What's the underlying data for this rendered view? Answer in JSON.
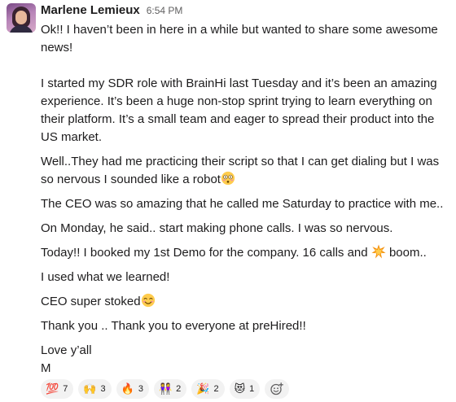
{
  "message": {
    "author": "Marlene Lemieux",
    "timestamp": "6:54 PM",
    "paragraphs": [
      "Ok!! I haven’t been in here in a while but wanted to share some awesome news!",
      "I started my SDR role with BrainHi last Tuesday and it’s been an amazing experience.  It’s been a huge non-stop sprint trying to learn everything on their platform.  It’s a small team and eager to spread their product into the US market.",
      "Well..They had me practicing their script so that I can get dialing but I was so nervous I sounded like a robot",
      "The CEO was so amazing that he called me Saturday to practice with me..",
      "On Monday, he said.. start making phone calls.  I was so nervous.",
      "Today!! I booked my 1st Demo for the company.  16 calls and",
      "boom..",
      "I used what we learned!",
      "CEO super stoked",
      "Thank you .. Thank you to everyone at preHired!!",
      "Love y’all",
      "M"
    ],
    "inline_emojis": [
      "flushed-face-emoji",
      "collision-emoji",
      "smiling-face-emoji"
    ]
  },
  "reactions": [
    {
      "icon": "hundred-points-emoji",
      "glyph": "💯",
      "count": "7"
    },
    {
      "icon": "raising-hands-emoji",
      "glyph": "🙌",
      "count": "3"
    },
    {
      "icon": "fire-emoji",
      "glyph": "🔥",
      "count": "3"
    },
    {
      "icon": "women-holding-hands-emoji",
      "glyph": "👭",
      "count": "2"
    },
    {
      "icon": "party-popper-emoji",
      "glyph": "🎉",
      "count": "2"
    },
    {
      "icon": "smiling-cat-heart-eyes-emoji",
      "glyph": "😻",
      "count": "1"
    }
  ],
  "add_reaction_icon": "add-reaction-icon"
}
